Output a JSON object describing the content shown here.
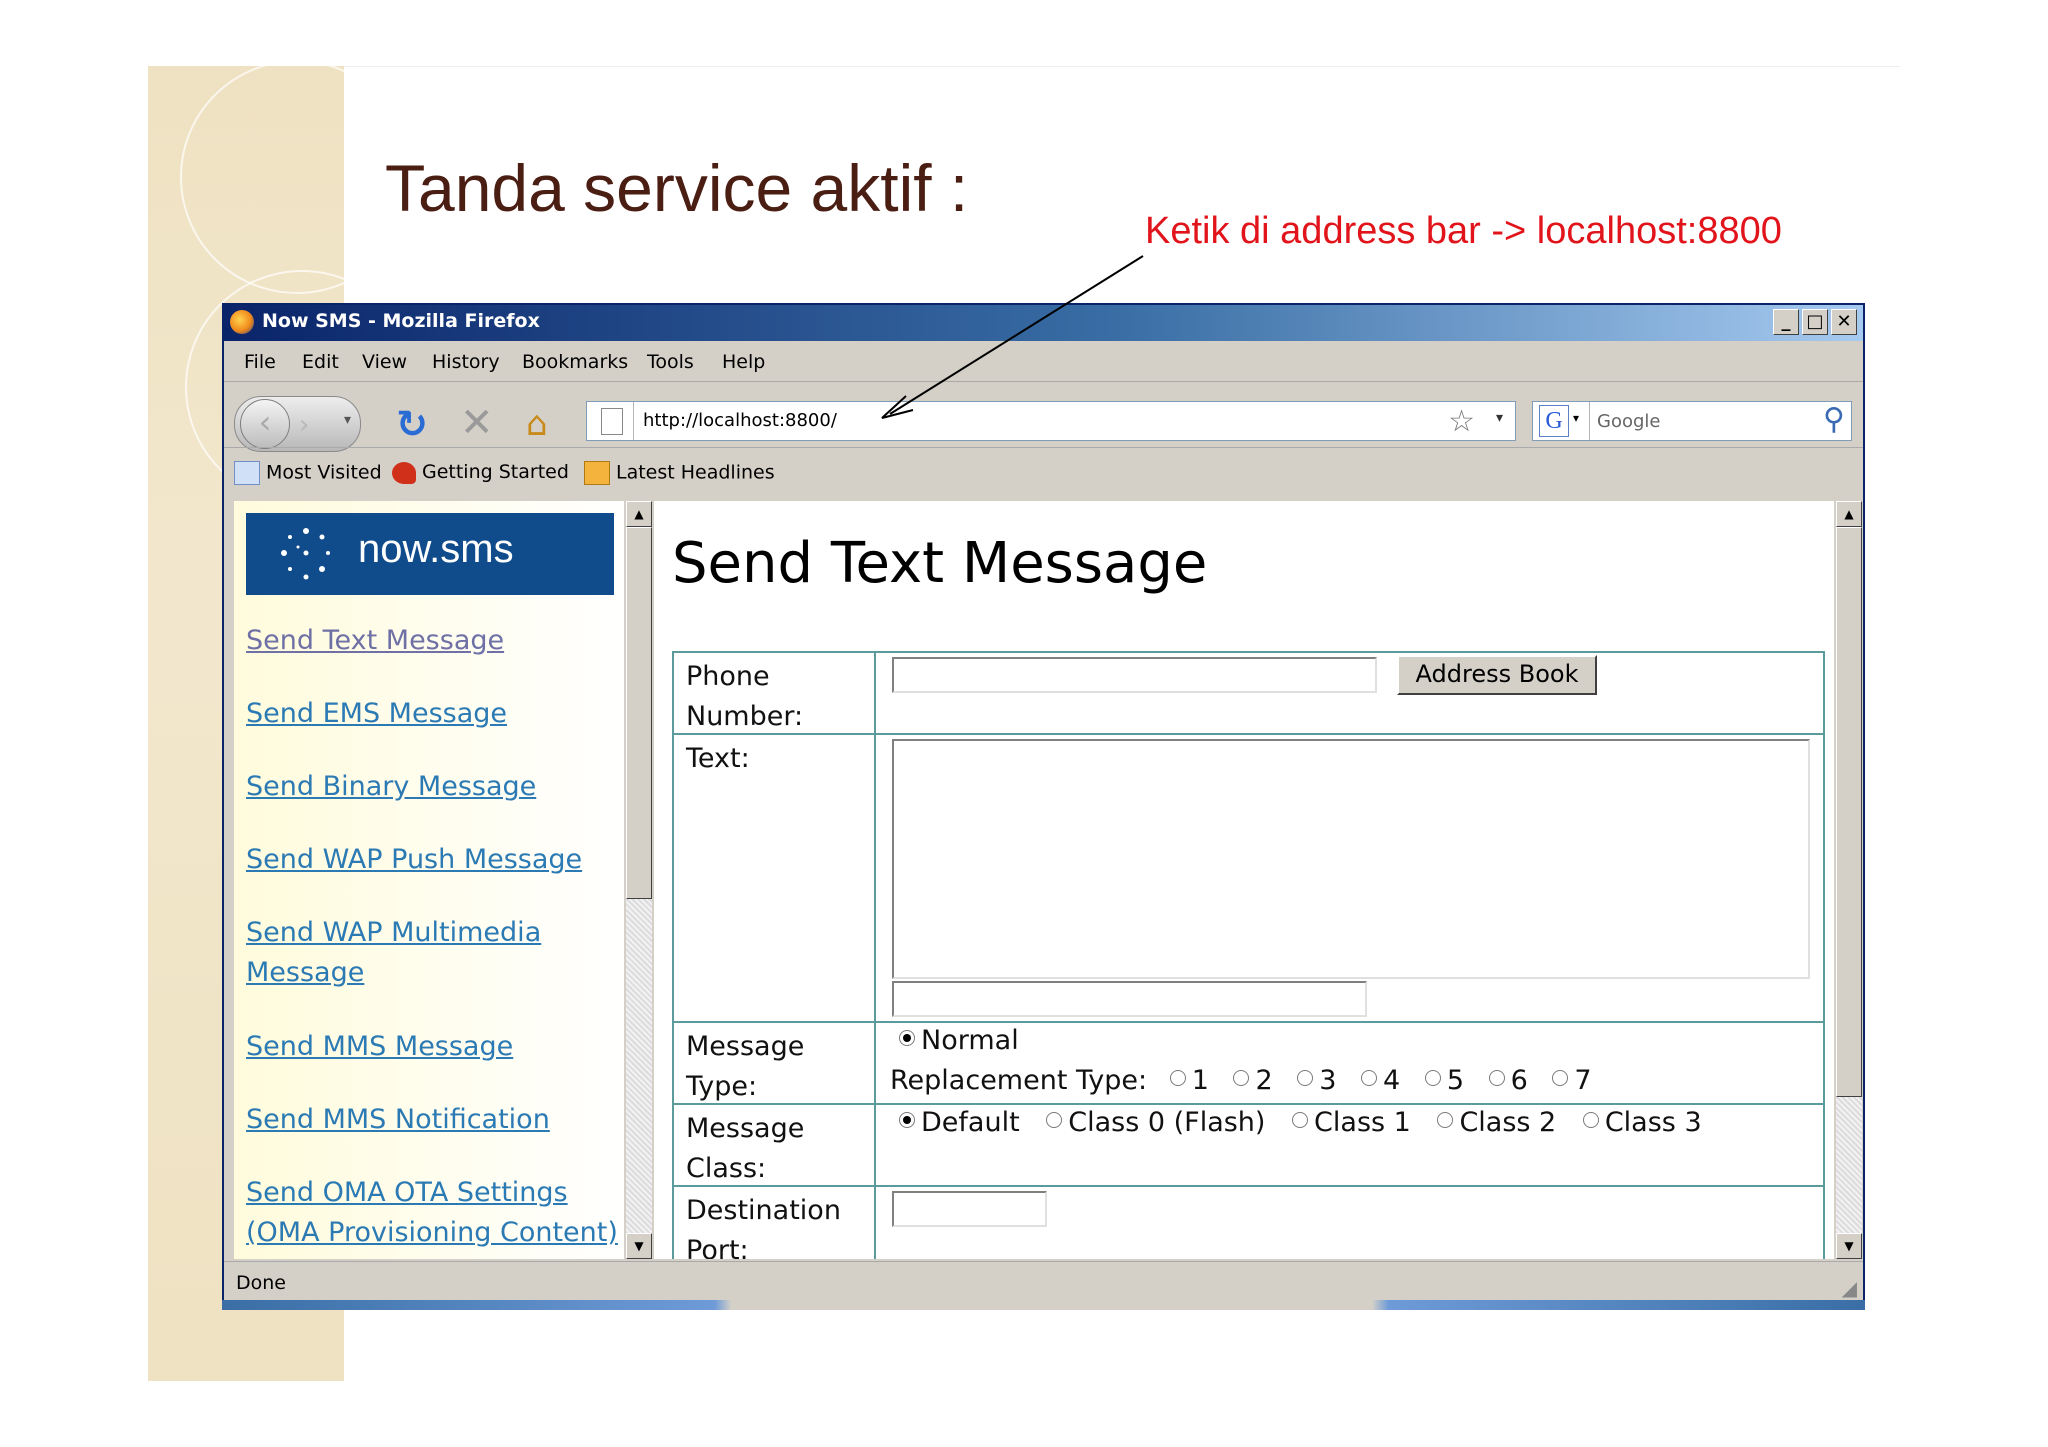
{
  "slide": {
    "title": "Tanda service aktif  :",
    "annotation": "Ketik di address bar -> localhost:8800"
  },
  "browser": {
    "window_title": "Now SMS - Mozilla Firefox",
    "menu": [
      "File",
      "Edit",
      "View",
      "History",
      "Bookmarks",
      "Tools",
      "Help"
    ],
    "url": "http://localhost:8800/",
    "search_placeholder": "Google",
    "bookmarks": [
      "Most Visited",
      "Getting Started",
      "Latest Headlines"
    ],
    "status": "Done",
    "icons": {
      "back": "back-arrow-icon",
      "forward": "forward-arrow-icon",
      "reload": "reload-icon",
      "stop": "stop-icon",
      "home": "home-icon",
      "bookmark_star": "star-icon",
      "search": "magnifier-icon"
    }
  },
  "sidebar": {
    "logo_text": "now.sms",
    "links": [
      "Send Text Message",
      "Send EMS Message",
      "Send Binary Message",
      "Send WAP Push Message",
      "Send WAP Multimedia",
      "Message",
      "Send MMS Message",
      "Send MMS Notification",
      "Send OMA OTA Settings",
      "(OMA Provisioning Content)"
    ]
  },
  "main": {
    "heading": "Send Text Message",
    "form": {
      "phone_label_1": "Phone",
      "phone_label_2": "Number:",
      "phone_value": "",
      "address_book_button": "Address Book",
      "text_label": "Text:",
      "text_value": "",
      "message_type_label_1": "Message",
      "message_type_label_2": "Type:",
      "message_type_normal": "Normal",
      "replacement_type_label": "Replacement Type:",
      "replacement_options": [
        "1",
        "2",
        "3",
        "4",
        "5",
        "6",
        "7"
      ],
      "message_class_label_1": "Message",
      "message_class_label_2": "Class:",
      "class_options": [
        "Default",
        "Class 0 (Flash)",
        "Class 1",
        "Class 2",
        "Class 3"
      ],
      "destination_port_label_1": "Destination",
      "destination_port_label_2": "Port:",
      "destination_port_value": ""
    }
  },
  "colors": {
    "slide_title": "#4a1e12",
    "annotation": "#e2141b",
    "link": "#2b7ab4",
    "logo_bg": "#104b8c",
    "form_border": "#5b9b9b"
  }
}
